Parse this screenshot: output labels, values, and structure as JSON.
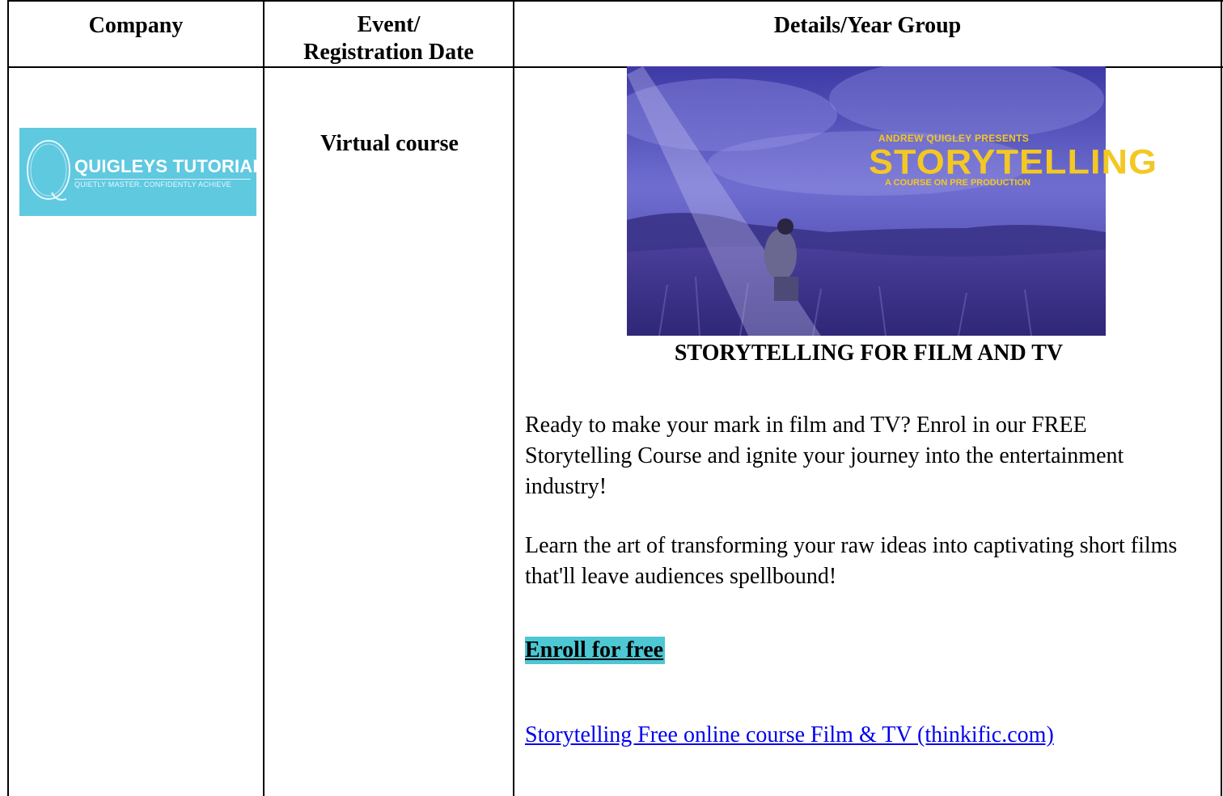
{
  "table": {
    "headers": {
      "company": "Company",
      "event_line1": "Event/",
      "event_line2": "Registration Date",
      "details": "Details/Year Group"
    }
  },
  "row": {
    "company_logo": {
      "title": "QUIGLEYS TUTORIALS",
      "tagline": "QUIETLY MASTER. CONFIDENTLY ACHIEVE",
      "color": "#5fc9e0"
    },
    "event": "Virtual course",
    "banner": {
      "presents": "ANDREW QUIGLEY PRESENTS",
      "title": "STORYTELLING",
      "subtitle": "A COURSE ON PRE PRODUCTION",
      "text_color": "#f3c823"
    },
    "caption": "STORYTELLING FOR FILM AND TV",
    "paragraph1": "Ready to make your mark in film and TV? Enrol in our FREE Storytelling Course and ignite your journey into the entertainment industry!",
    "paragraph2": "Learn the art of transforming your raw ideas into captivating short films that'll leave audiences spellbound!",
    "enroll_label": "Enroll for free",
    "enroll_highlight": "#4dc7d4",
    "course_link": "Storytelling Free online course Film & TV (thinkific.com)",
    "link_color": "#0000ee"
  }
}
